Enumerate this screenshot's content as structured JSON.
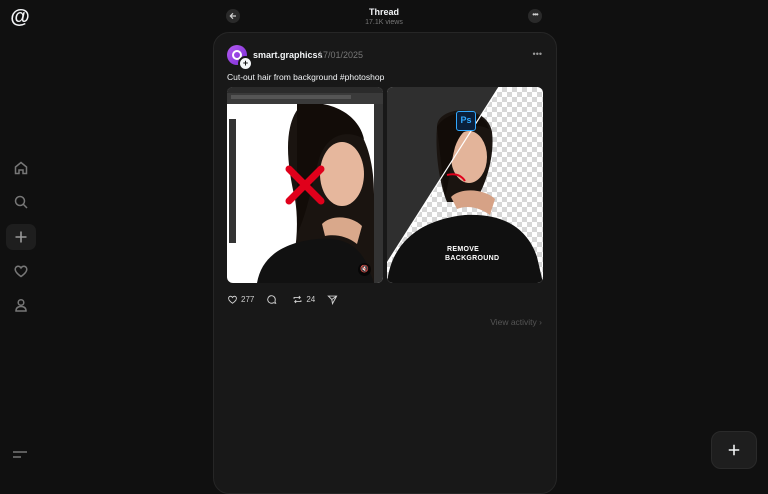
{
  "app": {
    "logo_icon": "threads-logo-icon",
    "logo_glyph": "@"
  },
  "sidebar": {
    "items": [
      {
        "name": "home",
        "icon": "home-icon"
      },
      {
        "name": "search",
        "icon": "search-icon"
      },
      {
        "name": "create",
        "icon": "plus-icon"
      },
      {
        "name": "activity",
        "icon": "heart-icon"
      },
      {
        "name": "profile",
        "icon": "person-icon"
      }
    ],
    "menu_icon": "menu-icon"
  },
  "header": {
    "title": "Thread",
    "views": "17.1K views"
  },
  "post": {
    "username": "smart.graphicss",
    "date": "17/01/2025",
    "text": "Cut-out hair from background #photoshop",
    "image2_label_line1": "REMOVE",
    "image2_label_line2": "BACKGROUND",
    "ps_logo_text": "Ps",
    "likes": "277",
    "reposts": "24",
    "view_activity": "View activity ›"
  },
  "colors": {
    "background": "#101010",
    "card": "#181818",
    "text": "#f3f5f7",
    "muted": "#777777",
    "accent_red": "#e0001b"
  }
}
